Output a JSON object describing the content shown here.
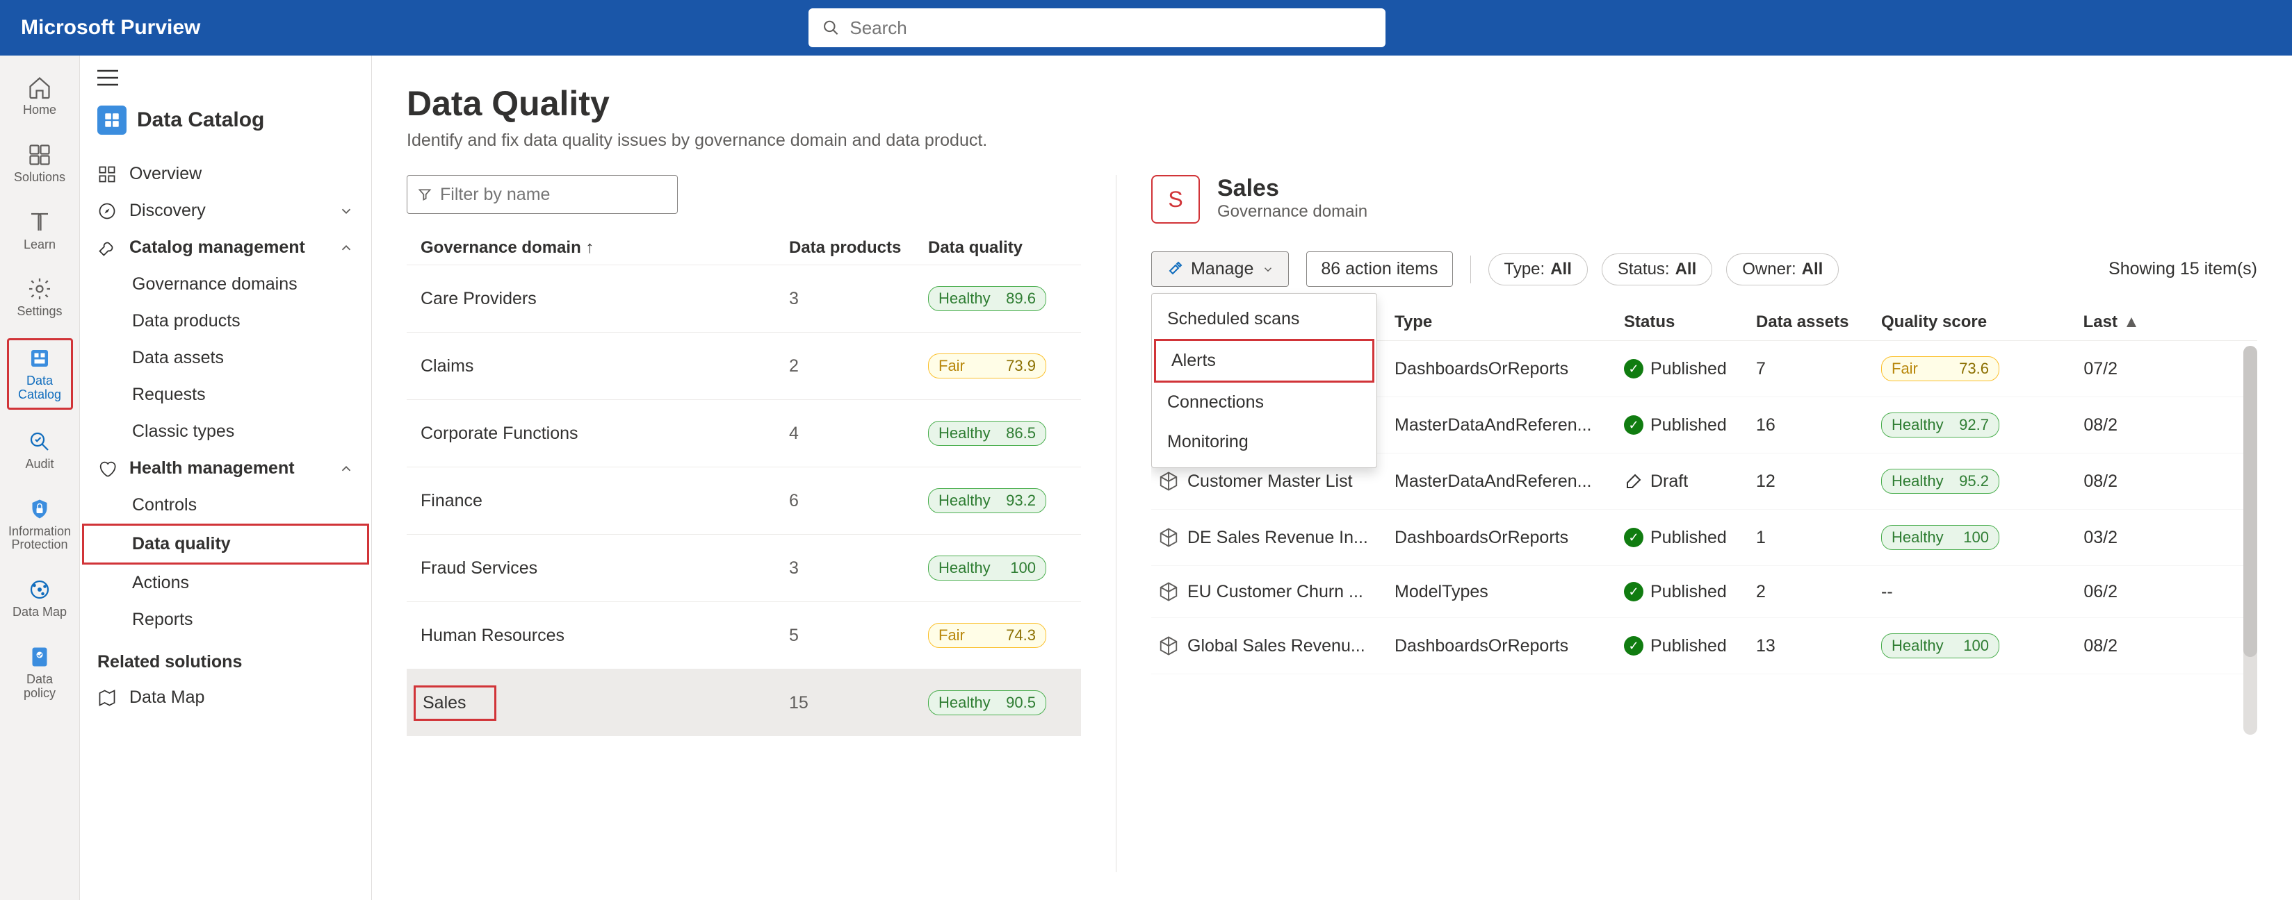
{
  "brand": "Microsoft Purview",
  "search_placeholder": "Search",
  "rail": [
    {
      "id": "home",
      "label": "Home"
    },
    {
      "id": "solutions",
      "label": "Solutions"
    },
    {
      "id": "learn",
      "label": "Learn"
    },
    {
      "id": "settings",
      "label": "Settings"
    },
    {
      "id": "data-catalog",
      "label": "Data Catalog",
      "active": true,
      "hl": true
    },
    {
      "id": "audit",
      "label": "Audit"
    },
    {
      "id": "info-protection",
      "label": "Information Protection"
    },
    {
      "id": "data-map",
      "label": "Data Map"
    },
    {
      "id": "data-policy",
      "label": "Data policy"
    }
  ],
  "col2": {
    "title": "Data Catalog",
    "items": [
      {
        "id": "overview",
        "label": "Overview",
        "icon": "grid"
      },
      {
        "id": "discovery",
        "label": "Discovery",
        "icon": "compass",
        "expand": true
      },
      {
        "id": "catalog-mgmt",
        "label": "Catalog management",
        "icon": "wrench",
        "expand": true,
        "open": true,
        "bold": true
      },
      {
        "id": "gov-domains",
        "label": "Governance domains",
        "sub": true
      },
      {
        "id": "data-products",
        "label": "Data products",
        "sub": true
      },
      {
        "id": "data-assets",
        "label": "Data assets",
        "sub": true
      },
      {
        "id": "requests",
        "label": "Requests",
        "sub": true
      },
      {
        "id": "classic-types",
        "label": "Classic types",
        "sub": true
      },
      {
        "id": "health-mgmt",
        "label": "Health management",
        "icon": "heart",
        "expand": true,
        "open": true,
        "bold": true
      },
      {
        "id": "controls",
        "label": "Controls",
        "sub": true
      },
      {
        "id": "data-quality",
        "label": "Data quality",
        "sub": true,
        "sel": true,
        "hl": true
      },
      {
        "id": "actions",
        "label": "Actions",
        "sub": true
      },
      {
        "id": "reports",
        "label": "Reports",
        "sub": true
      }
    ],
    "related_title": "Related solutions",
    "related": [
      {
        "id": "data-map",
        "label": "Data Map",
        "icon": "map"
      }
    ]
  },
  "page": {
    "title": "Data Quality",
    "subtitle": "Identify and fix data quality issues by governance domain and data product.",
    "filter_placeholder": "Filter by name",
    "dom_headers": {
      "c1": "Governance domain",
      "c2": "Data products",
      "c3": "Data quality"
    },
    "domains": [
      {
        "name": "Care Providers",
        "products": "3",
        "quality": "Healthy",
        "score": "89.6"
      },
      {
        "name": "Claims",
        "products": "2",
        "quality": "Fair",
        "score": "73.9"
      },
      {
        "name": "Corporate Functions",
        "products": "4",
        "quality": "Healthy",
        "score": "86.5"
      },
      {
        "name": "Finance",
        "products": "6",
        "quality": "Healthy",
        "score": "93.2"
      },
      {
        "name": "Fraud Services",
        "products": "3",
        "quality": "Healthy",
        "score": "100"
      },
      {
        "name": "Human Resources",
        "products": "5",
        "quality": "Fair",
        "score": "74.3"
      },
      {
        "name": "Sales",
        "products": "15",
        "quality": "Healthy",
        "score": "90.5",
        "sel": true,
        "hl": true
      }
    ]
  },
  "detail": {
    "avatar": "S",
    "title": "Sales",
    "subtitle": "Governance domain",
    "manage_label": "Manage",
    "action_items": "86 action items",
    "pills": [
      {
        "k": "Type: ",
        "v": "All"
      },
      {
        "k": "Status: ",
        "v": "All"
      },
      {
        "k": "Owner: ",
        "v": "All"
      }
    ],
    "showing": "Showing 15 item(s)",
    "dropdown": [
      {
        "label": "Scheduled scans"
      },
      {
        "label": "Alerts",
        "hl": true
      },
      {
        "label": "Connections"
      },
      {
        "label": "Monitoring"
      }
    ],
    "headers": {
      "type": "Type",
      "status": "Status",
      "assets": "Data assets",
      "score": "Quality score",
      "last": "Last"
    },
    "rows": [
      {
        "name": "",
        "type": "DashboardsOrReports",
        "status": "Published",
        "status_kind": "published",
        "assets": "7",
        "quality": "Fair",
        "score": "73.6",
        "last": "07/2"
      },
      {
        "name": "",
        "type": "MasterDataAndReferen...",
        "status": "Published",
        "status_kind": "published",
        "assets": "16",
        "quality": "Healthy",
        "score": "92.7",
        "last": "08/2"
      },
      {
        "name": "Customer Master List",
        "type": "MasterDataAndReferen...",
        "status": "Draft",
        "status_kind": "draft",
        "assets": "12",
        "quality": "Healthy",
        "score": "95.2",
        "last": "08/2"
      },
      {
        "name": "DE Sales Revenue In...",
        "type": "DashboardsOrReports",
        "status": "Published",
        "status_kind": "published",
        "assets": "1",
        "quality": "Healthy",
        "score": "100",
        "last": "03/2"
      },
      {
        "name": "EU Customer Churn ...",
        "type": "ModelTypes",
        "status": "Published",
        "status_kind": "published",
        "assets": "2",
        "quality": "",
        "score": "--",
        "last": "06/2"
      },
      {
        "name": "Global Sales Revenu...",
        "type": "DashboardsOrReports",
        "status": "Published",
        "status_kind": "published",
        "assets": "13",
        "quality": "Healthy",
        "score": "100",
        "last": "08/2"
      }
    ]
  }
}
